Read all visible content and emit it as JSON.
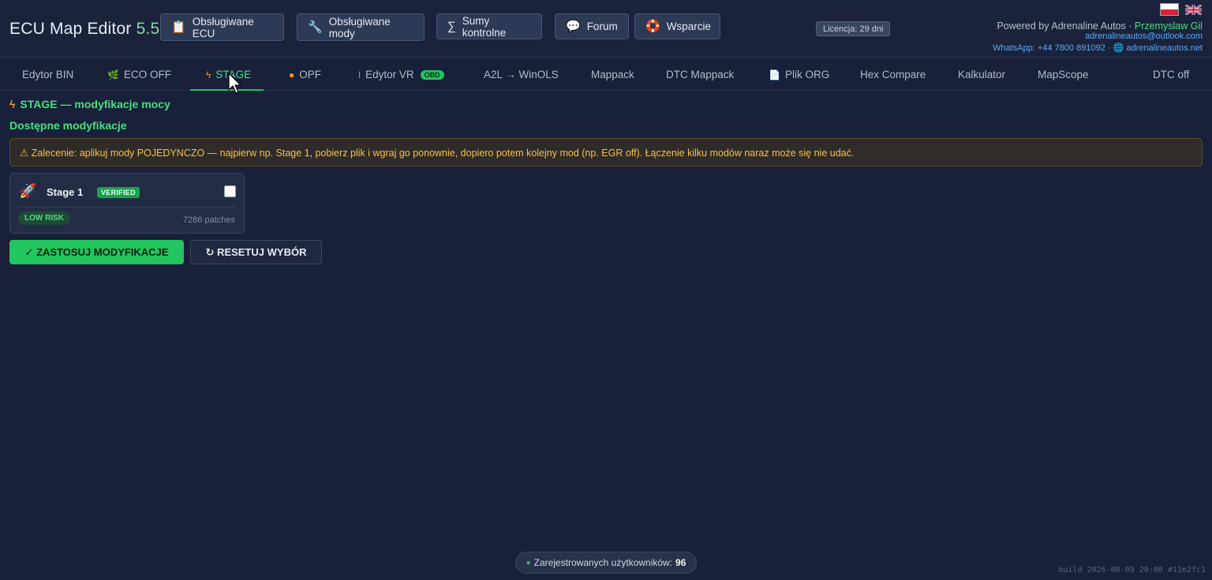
{
  "header": {
    "title": "ECU Map Editor",
    "version": "5.5",
    "buttons": [
      {
        "label": "Obsługiwane ECU",
        "icon": "clipboard-icon"
      },
      {
        "label": "Obsługiwane mody",
        "icon": "wrench-icon"
      },
      {
        "label": "Sumy kontrolne",
        "icon": "sigma-icon"
      },
      {
        "label": "Forum",
        "icon": "speech-bubble-icon"
      },
      {
        "label": "Wsparcie",
        "icon": "lifebuoy-icon"
      }
    ],
    "license": "Licencja: 29 dni",
    "powered_by": "Powered by Adrenaline Autos · ",
    "owner": "Przemyslaw Gil",
    "email": "adrenalineautos@outlook.com",
    "whatsapp": "WhatsApp: +44 7800 891092 · ",
    "website": "adrenalineautos.net",
    "colors": {
      "accent": "#22c55e",
      "link": "#5ba9f5",
      "warning": "#f5c14a"
    }
  },
  "tabs": [
    {
      "label": "Edytor BIN",
      "icon": ""
    },
    {
      "label": "ECO OFF",
      "icon": "leaf-icon"
    },
    {
      "label": "STAGE",
      "icon": "bolt-icon",
      "active": true
    },
    {
      "label": "OPF",
      "icon": "drop-icon"
    },
    {
      "label": "Edytor VR",
      "icon": "pin-icon",
      "badge": "OBD"
    },
    {
      "label": "A2L → WinOLS",
      "icon": ""
    },
    {
      "label": "Mappack",
      "icon": ""
    },
    {
      "label": "DTC Mappack",
      "icon": ""
    },
    {
      "label": "Plik ORG",
      "icon": "document-icon"
    },
    {
      "label": "Hex Compare",
      "icon": ""
    },
    {
      "label": "Kalkulator",
      "icon": ""
    },
    {
      "label": "MapScope",
      "icon": ""
    },
    {
      "label": "DTC off",
      "icon": ""
    }
  ],
  "main": {
    "section_title": "STAGE — modyfikacje mocy",
    "subtitle": "Dostępne modyfikacje",
    "warning": "⚠ Zalecenie: aplikuj mody POJEDYNCZO — najpierw np. Stage 1, pobierz plik i wgraj go ponownie, dopiero potem kolejny mod (np. EGR off). Łączenie kilku modów naraz może się nie udać.",
    "mod_card": {
      "name": "Stage 1",
      "badge": "VERIFIED",
      "risk": "LOW RISK",
      "patches": "7286 patches",
      "checked": false
    },
    "apply_label": "✓ ZASTOSUJ MODYFIKACJE",
    "reset_label": "↻ RESETUJ WYBÓR"
  },
  "footer": {
    "users_label": "Zarejestrowanych użytkowników:",
    "users_count": "96",
    "build": "build 2026-08-09 20:00 #11e2fc1"
  }
}
